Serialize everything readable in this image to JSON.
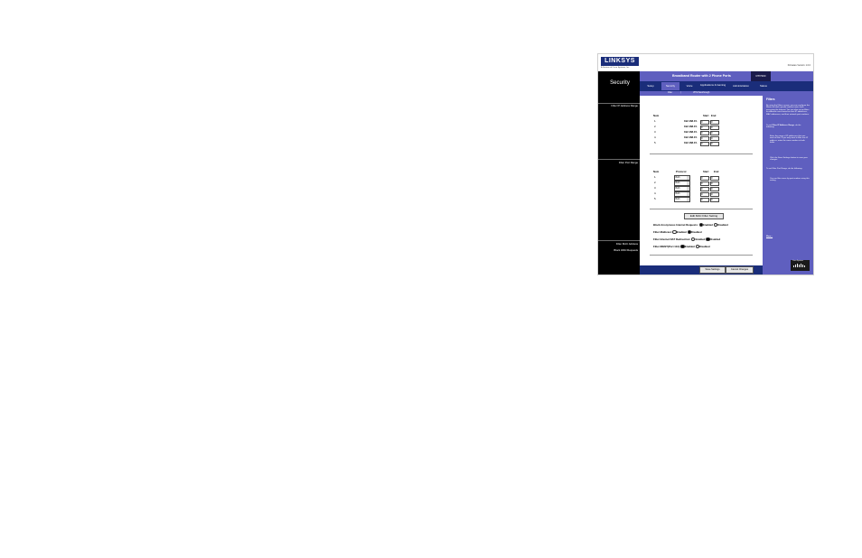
{
  "header": {
    "logo": "LINKSYS",
    "logo_sub": "A Division of Cisco Systems, Inc.",
    "firmware": "Firmware Version: 1.0.0",
    "product": "Broadband Router with 2 Phone Ports",
    "model": "RTP300",
    "section_title": "Security"
  },
  "tabs": [
    {
      "label": "Setup"
    },
    {
      "label": "Security"
    },
    {
      "label": "Voice"
    },
    {
      "label": "Applications & Gaming"
    },
    {
      "label": "Administration"
    },
    {
      "label": "Status"
    }
  ],
  "subtabs": [
    {
      "label": "Filter"
    },
    {
      "label": "VPN Passthrough"
    }
  ],
  "left_labels": {
    "filter_ip": "Filter IP Address Range",
    "filter_port": "Filter Port Range",
    "filter_mac": "Filter MAC Address",
    "block_wan": "Block WAN Requests"
  },
  "ip_table": {
    "header_num": "Num",
    "header_start": "Start",
    "header_end": "End",
    "ip_prefix": "192.168.15.",
    "rows": [
      {
        "num": "1.",
        "start": "0",
        "end": "0"
      },
      {
        "num": "2.",
        "start": "0",
        "end": "0"
      },
      {
        "num": "3.",
        "start": "0",
        "end": "0"
      },
      {
        "num": "4.",
        "start": "0",
        "end": "0"
      },
      {
        "num": "5.",
        "start": "0",
        "end": "0"
      }
    ]
  },
  "port_table": {
    "header_num": "Num",
    "header_protocol": "Protocol",
    "header_start": "Start",
    "header_end": "End",
    "rows": [
      {
        "num": "1.",
        "protocol": "Both",
        "start": "0",
        "end": "0"
      },
      {
        "num": "2.",
        "protocol": "Both",
        "start": "0",
        "end": "0"
      },
      {
        "num": "3.",
        "protocol": "Both",
        "start": "0",
        "end": "0"
      },
      {
        "num": "4.",
        "protocol": "Both",
        "start": "0",
        "end": "0"
      },
      {
        "num": "5.",
        "protocol": "Both",
        "start": "0",
        "end": "0"
      }
    ]
  },
  "mac_button": "Edit MAC Filter Setting",
  "wan": {
    "block_anon": "Block Anonymous Internet Requests:",
    "filter_multicast": "Filter Multicast:",
    "filter_nat": "Filter Internet NAT Redirection:",
    "filter_ident": "Filter IDENT(Port 113):",
    "enabled": "Enabled",
    "disabled": "Disabled"
  },
  "actions": {
    "save": "Save Settings",
    "cancel": "Cancel Changes"
  },
  "help": {
    "title": "Filters",
    "p1": "By using the Filters screen, you can configure the Router to block specific internet users from accessing the Internet. You can also set up filters for different users based on their IP addresses, MAC addresses, and their network port numbers.",
    "p2_a": "To set",
    "p2_b": "Filter IP Address Range",
    "p2_c": ", do the following:",
    "l1": "Enter the range of IP addresses that you want to filter. If you only want to filter one IP address, enter the same number in both fields.",
    "l2": "Click the Save Settings button to save your changes.",
    "p3": "To set Filter Port Range, do the following:",
    "l3": "You can filter users by port number using this setting.",
    "more": "More...",
    "cisco": "Cisco Systems"
  }
}
